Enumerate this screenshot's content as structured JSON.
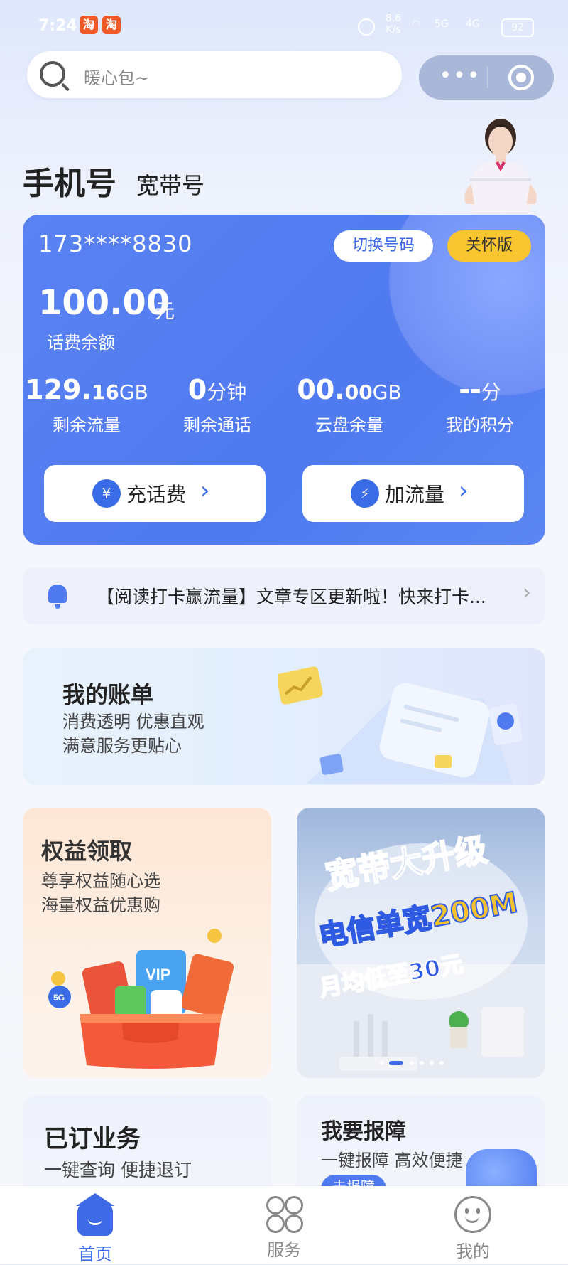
{
  "status_bar": {
    "time": "7:24",
    "app_badges": [
      "淘",
      "淘"
    ],
    "net_speed": "8.6 K/s",
    "signal": [
      "5G",
      "4G"
    ],
    "battery": "92"
  },
  "search": {
    "placeholder": "暖心包~"
  },
  "capsule": {
    "more": "•••"
  },
  "account_tabs": {
    "phone": "手机号",
    "broadband": "宽带号"
  },
  "card": {
    "phone_number": "173****8830",
    "switch_label": "切换号码",
    "care_label": "关怀版",
    "balance_value": "100.00",
    "balance_unit": "元",
    "balance_label": "话费余额",
    "stats": [
      {
        "big": "129.",
        "small_num": "16",
        "unit": "GB",
        "label": "剩余流量"
      },
      {
        "big": "0",
        "small_num": "",
        "unit": "分钟",
        "label": "剩余通话"
      },
      {
        "big": "00.",
        "small_num": "00",
        "unit": "GB",
        "label": "云盘余量"
      },
      {
        "big": "--",
        "small_num": "",
        "unit": "分",
        "label": "我的积分"
      }
    ],
    "recharge_label": "充话费",
    "add_data_label": "加流量"
  },
  "notice": {
    "text": "【阅读打卡赢流量】文章专区更新啦！快来打卡..."
  },
  "bill": {
    "title": "我的账单",
    "line1": "消费透明 优惠直观",
    "line2": "满意服务更贴心"
  },
  "rights": {
    "title": "权益领取",
    "line1": "尊享权益随心选",
    "line2": "海量权益优惠购",
    "art_vip": "VIP",
    "art_5g": "5G"
  },
  "promo": {
    "line1": "宽带大升级",
    "line2": "电信单宽200M",
    "line3": "月均低至30元"
  },
  "subscribed": {
    "title": "已订业务",
    "desc": "一键查询 便捷退订"
  },
  "repair": {
    "title": "我要报障",
    "desc": "一键报障 高效便捷",
    "btn": "去报障"
  },
  "tabbar": {
    "home": "首页",
    "service": "服务",
    "mine": "我的"
  },
  "colors": {
    "primary": "#4f7af0",
    "care": "#f9c531",
    "tab_active": "#3e6ae6"
  }
}
